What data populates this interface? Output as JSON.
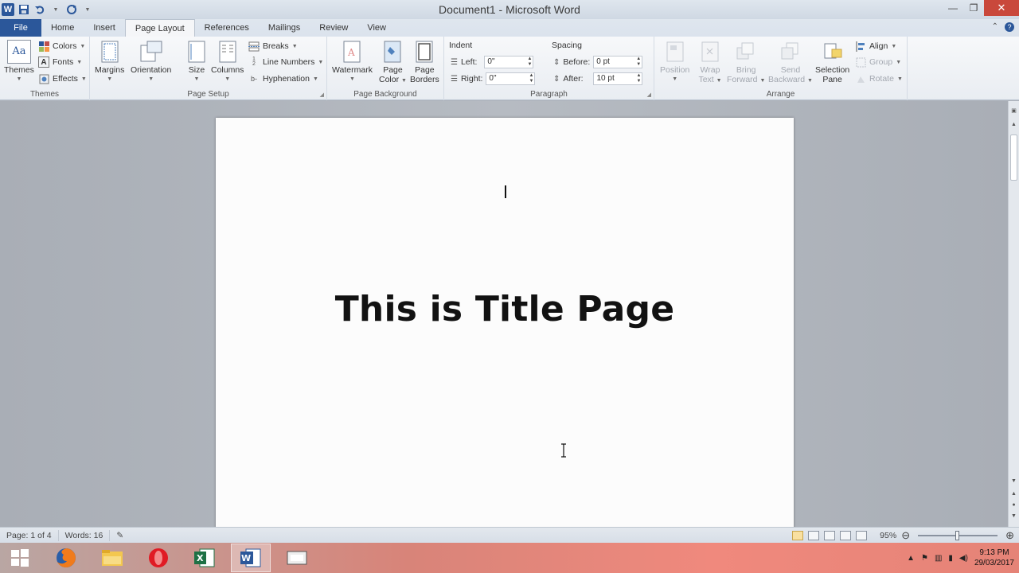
{
  "window": {
    "title": "Document1 - Microsoft Word"
  },
  "qat": {
    "app_icon": "W"
  },
  "tabs": [
    {
      "label": "File"
    },
    {
      "label": "Home"
    },
    {
      "label": "Insert"
    },
    {
      "label": "Page Layout"
    },
    {
      "label": "References"
    },
    {
      "label": "Mailings"
    },
    {
      "label": "Review"
    },
    {
      "label": "View"
    }
  ],
  "ribbon": {
    "themes": {
      "group": "Themes",
      "themes": "Themes",
      "colors": "Colors",
      "fonts": "Fonts",
      "effects": "Effects",
      "icon_text": "Aa"
    },
    "page_setup": {
      "group": "Page Setup",
      "margins": "Margins",
      "orientation": "Orientation",
      "size": "Size",
      "columns": "Columns",
      "breaks": "Breaks",
      "line_numbers": "Line Numbers",
      "hyphenation": "Hyphenation"
    },
    "page_background": {
      "group": "Page Background",
      "watermark": "Watermark",
      "page_color_1": "Page",
      "page_color_2": "Color",
      "page_borders_1": "Page",
      "page_borders_2": "Borders"
    },
    "paragraph": {
      "group": "Paragraph",
      "indent": "Indent",
      "spacing": "Spacing",
      "left_label": "Left:",
      "left_value": "0\"",
      "right_label": "Right:",
      "right_value": "0\"",
      "before_label": "Before:",
      "before_value": "0 pt",
      "after_label": "After:",
      "after_value": "10 pt"
    },
    "arrange": {
      "group": "Arrange",
      "position": "Position",
      "wrap_1": "Wrap",
      "wrap_2": "Text",
      "bring_1": "Bring",
      "bring_2": "Forward",
      "send_1": "Send",
      "send_2": "Backward",
      "selection_1": "Selection",
      "selection_2": "Pane",
      "align": "Align",
      "group_btn": "Group",
      "rotate": "Rotate"
    }
  },
  "document": {
    "title": "This is Title Page"
  },
  "status": {
    "page": "Page: 1 of 4",
    "words": "Words: 16",
    "zoom": "95%",
    "zoom_level": 0.5
  },
  "taskbar": {
    "time": "9:13 PM",
    "date": "29/03/2017"
  },
  "colors": {
    "accent": "#2b579a",
    "close": "#c9483b"
  }
}
